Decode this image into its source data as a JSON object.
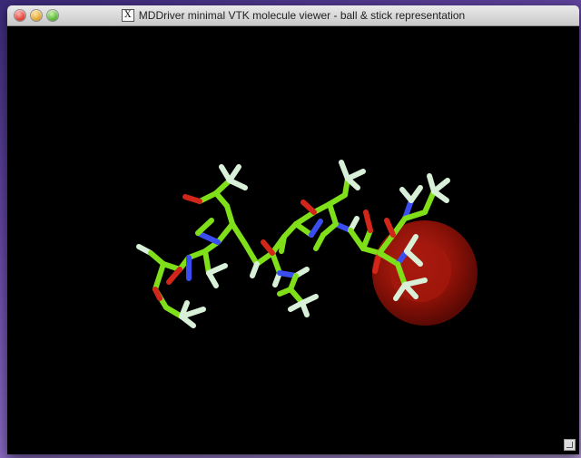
{
  "window": {
    "title": "MDDriver minimal VTK molecule viewer - ball & stick representation",
    "title_icon": "X",
    "controls": [
      "close",
      "minimize",
      "zoom"
    ]
  },
  "scene": {
    "representation": "ball & stick",
    "background_color": "#000000",
    "colors": {
      "carbon": "#7fe01a",
      "hydrogen": "#d8f0d8",
      "nitrogen": "#3a4ef0",
      "oxygen": "#d2261a",
      "highlight_sphere": "#8e1208"
    }
  }
}
